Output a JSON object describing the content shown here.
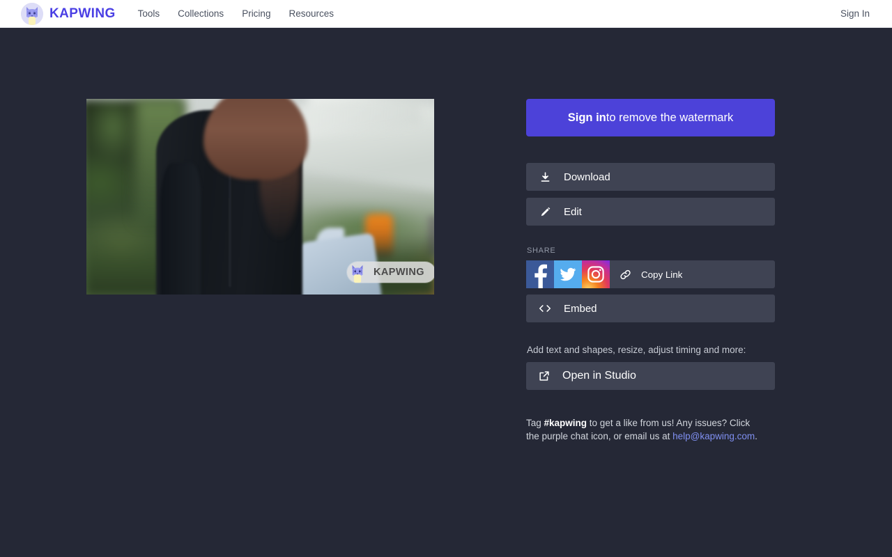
{
  "header": {
    "brand_name": "KAPWING",
    "brand_icon": "kapwing-cat-logo",
    "nav": [
      {
        "label": "Tools"
      },
      {
        "label": "Collections"
      },
      {
        "label": "Pricing"
      },
      {
        "label": "Resources"
      }
    ],
    "signin_label": "Sign In"
  },
  "preview": {
    "watermark_text": "KAPWING",
    "watermark_icon": "kapwing-cat-logo"
  },
  "panel": {
    "primary": {
      "strong": "Sign in",
      "rest": " to remove the watermark"
    },
    "download": {
      "label": "Download",
      "icon": "download-icon"
    },
    "edit": {
      "label": "Edit",
      "icon": "pencil-icon"
    },
    "share": {
      "title": "SHARE",
      "facebook_icon": "facebook-icon",
      "twitter_icon": "twitter-icon",
      "instagram_icon": "instagram-icon",
      "copy_link": {
        "label": "Copy Link",
        "icon": "link-icon"
      },
      "embed": {
        "label": "Embed",
        "icon": "code-brackets-icon"
      }
    },
    "studio": {
      "hint": "Add text and shapes, resize, adjust timing and more:",
      "label": "Open in Studio",
      "icon": "external-link-icon"
    },
    "footer": {
      "part1": "Tag ",
      "tag": "#kapwing",
      "part2": " to get a like from us! Any issues? Click the purple chat icon, or email us at ",
      "email": "help@kapwing.com",
      "part3": "."
    }
  },
  "colors": {
    "background": "#252836",
    "header_bg": "#ffffff",
    "accent": "#4c42d9",
    "button_bg": "#3f4353",
    "link": "#7f8ff0",
    "facebook": "#3b5998",
    "twitter": "#55acee"
  }
}
